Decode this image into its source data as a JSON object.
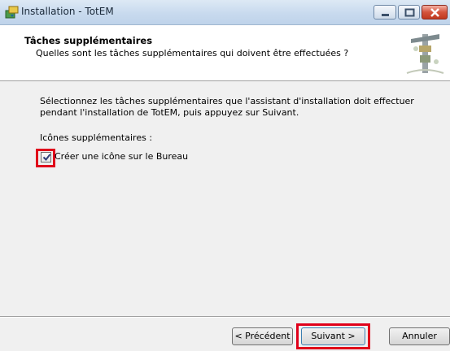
{
  "window": {
    "title": "Installation - TotEM",
    "icon": "installer-icon"
  },
  "header": {
    "title": "Tâches supplémentaires",
    "subtitle": "Quelles sont les tâches supplémentaires qui doivent être effectuées ?",
    "image": "totem-pole-image"
  },
  "body": {
    "description": "Sélectionnez les tâches supplémentaires que l'assistant d'installation doit effectuer pendant l'installation de TotEM, puis appuyez sur Suivant.",
    "section_label": "Icônes supplémentaires :",
    "checkbox": {
      "label": "Créer une icône sur le Bureau",
      "checked": true
    }
  },
  "buttons": {
    "previous": "< Précédent",
    "next": "Suivant >",
    "cancel": "Annuler"
  },
  "colors": {
    "highlight": "#e0001a"
  }
}
